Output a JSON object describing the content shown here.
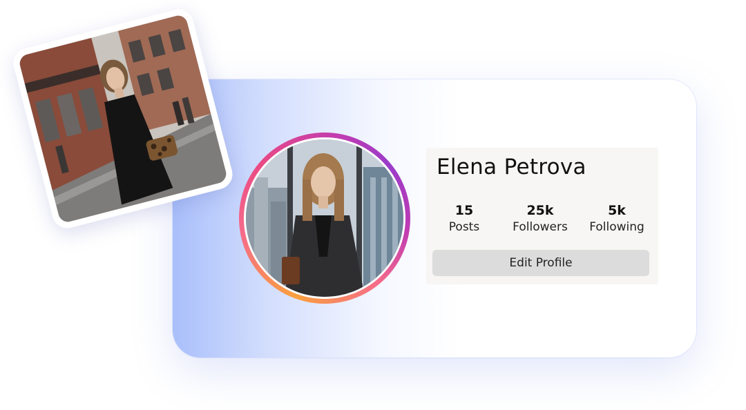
{
  "profile": {
    "name": "Elena Petrova",
    "stats": [
      {
        "value": "15",
        "label": "Posts"
      },
      {
        "value": "25k",
        "label": "Followers"
      },
      {
        "value": "5k",
        "label": "Following"
      }
    ],
    "edit_button_label": "Edit Profile"
  },
  "colors": {
    "card_gradient_start": "#a9bffb",
    "ring_gradient": [
      "#f9a03f",
      "#f56b8a",
      "#c13cb1",
      "#9a3cc9"
    ],
    "button_bg": "#dcdcdc"
  }
}
